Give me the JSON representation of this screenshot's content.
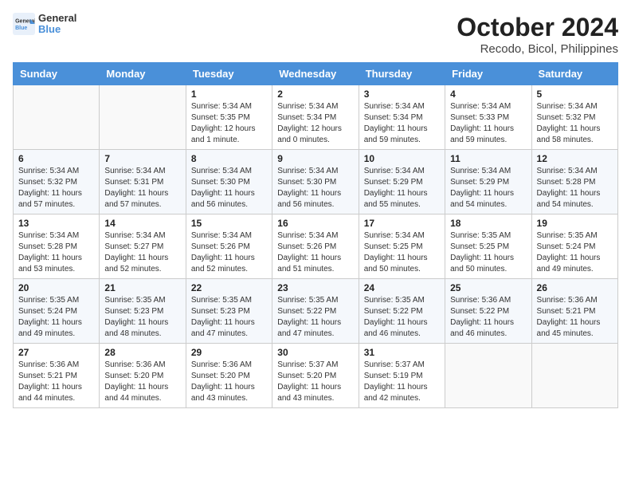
{
  "header": {
    "logo_general": "General",
    "logo_blue": "Blue",
    "title": "October 2024",
    "subtitle": "Recodo, Bicol, Philippines"
  },
  "weekdays": [
    "Sunday",
    "Monday",
    "Tuesday",
    "Wednesday",
    "Thursday",
    "Friday",
    "Saturday"
  ],
  "weeks": [
    [
      {
        "day": "",
        "info": ""
      },
      {
        "day": "",
        "info": ""
      },
      {
        "day": "1",
        "info": "Sunrise: 5:34 AM\nSunset: 5:35 PM\nDaylight: 12 hours and 1 minute."
      },
      {
        "day": "2",
        "info": "Sunrise: 5:34 AM\nSunset: 5:34 PM\nDaylight: 12 hours and 0 minutes."
      },
      {
        "day": "3",
        "info": "Sunrise: 5:34 AM\nSunset: 5:34 PM\nDaylight: 11 hours and 59 minutes."
      },
      {
        "day": "4",
        "info": "Sunrise: 5:34 AM\nSunset: 5:33 PM\nDaylight: 11 hours and 59 minutes."
      },
      {
        "day": "5",
        "info": "Sunrise: 5:34 AM\nSunset: 5:32 PM\nDaylight: 11 hours and 58 minutes."
      }
    ],
    [
      {
        "day": "6",
        "info": "Sunrise: 5:34 AM\nSunset: 5:32 PM\nDaylight: 11 hours and 57 minutes."
      },
      {
        "day": "7",
        "info": "Sunrise: 5:34 AM\nSunset: 5:31 PM\nDaylight: 11 hours and 57 minutes."
      },
      {
        "day": "8",
        "info": "Sunrise: 5:34 AM\nSunset: 5:30 PM\nDaylight: 11 hours and 56 minutes."
      },
      {
        "day": "9",
        "info": "Sunrise: 5:34 AM\nSunset: 5:30 PM\nDaylight: 11 hours and 56 minutes."
      },
      {
        "day": "10",
        "info": "Sunrise: 5:34 AM\nSunset: 5:29 PM\nDaylight: 11 hours and 55 minutes."
      },
      {
        "day": "11",
        "info": "Sunrise: 5:34 AM\nSunset: 5:29 PM\nDaylight: 11 hours and 54 minutes."
      },
      {
        "day": "12",
        "info": "Sunrise: 5:34 AM\nSunset: 5:28 PM\nDaylight: 11 hours and 54 minutes."
      }
    ],
    [
      {
        "day": "13",
        "info": "Sunrise: 5:34 AM\nSunset: 5:28 PM\nDaylight: 11 hours and 53 minutes."
      },
      {
        "day": "14",
        "info": "Sunrise: 5:34 AM\nSunset: 5:27 PM\nDaylight: 11 hours and 52 minutes."
      },
      {
        "day": "15",
        "info": "Sunrise: 5:34 AM\nSunset: 5:26 PM\nDaylight: 11 hours and 52 minutes."
      },
      {
        "day": "16",
        "info": "Sunrise: 5:34 AM\nSunset: 5:26 PM\nDaylight: 11 hours and 51 minutes."
      },
      {
        "day": "17",
        "info": "Sunrise: 5:34 AM\nSunset: 5:25 PM\nDaylight: 11 hours and 50 minutes."
      },
      {
        "day": "18",
        "info": "Sunrise: 5:35 AM\nSunset: 5:25 PM\nDaylight: 11 hours and 50 minutes."
      },
      {
        "day": "19",
        "info": "Sunrise: 5:35 AM\nSunset: 5:24 PM\nDaylight: 11 hours and 49 minutes."
      }
    ],
    [
      {
        "day": "20",
        "info": "Sunrise: 5:35 AM\nSunset: 5:24 PM\nDaylight: 11 hours and 49 minutes."
      },
      {
        "day": "21",
        "info": "Sunrise: 5:35 AM\nSunset: 5:23 PM\nDaylight: 11 hours and 48 minutes."
      },
      {
        "day": "22",
        "info": "Sunrise: 5:35 AM\nSunset: 5:23 PM\nDaylight: 11 hours and 47 minutes."
      },
      {
        "day": "23",
        "info": "Sunrise: 5:35 AM\nSunset: 5:22 PM\nDaylight: 11 hours and 47 minutes."
      },
      {
        "day": "24",
        "info": "Sunrise: 5:35 AM\nSunset: 5:22 PM\nDaylight: 11 hours and 46 minutes."
      },
      {
        "day": "25",
        "info": "Sunrise: 5:36 AM\nSunset: 5:22 PM\nDaylight: 11 hours and 46 minutes."
      },
      {
        "day": "26",
        "info": "Sunrise: 5:36 AM\nSunset: 5:21 PM\nDaylight: 11 hours and 45 minutes."
      }
    ],
    [
      {
        "day": "27",
        "info": "Sunrise: 5:36 AM\nSunset: 5:21 PM\nDaylight: 11 hours and 44 minutes."
      },
      {
        "day": "28",
        "info": "Sunrise: 5:36 AM\nSunset: 5:20 PM\nDaylight: 11 hours and 44 minutes."
      },
      {
        "day": "29",
        "info": "Sunrise: 5:36 AM\nSunset: 5:20 PM\nDaylight: 11 hours and 43 minutes."
      },
      {
        "day": "30",
        "info": "Sunrise: 5:37 AM\nSunset: 5:20 PM\nDaylight: 11 hours and 43 minutes."
      },
      {
        "day": "31",
        "info": "Sunrise: 5:37 AM\nSunset: 5:19 PM\nDaylight: 11 hours and 42 minutes."
      },
      {
        "day": "",
        "info": ""
      },
      {
        "day": "",
        "info": ""
      }
    ]
  ]
}
